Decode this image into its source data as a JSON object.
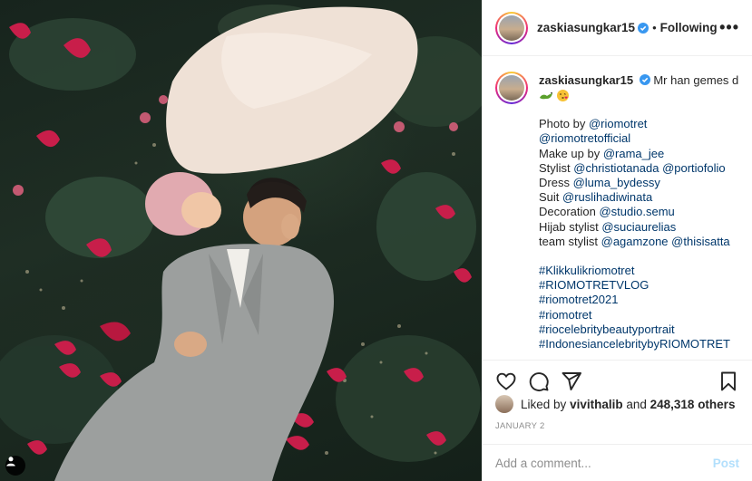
{
  "post": {
    "username": "zaskiasungkar15",
    "follow_status": "Following",
    "more_label": "•••"
  },
  "caption": {
    "username": "zaskiasungkar15",
    "text": "Mr han gemes d",
    "emojis": [
      "lizard",
      "kissing-heart-face"
    ],
    "lines": [
      {
        "prefix": "Photo by ",
        "link": "@riomotret"
      },
      {
        "prefix": "",
        "link": "@riomotretofficial"
      },
      {
        "prefix": "Make up by ",
        "link": "@rama_jee"
      },
      {
        "prefix": "Stylist ",
        "link": "@christiotanada",
        "link2": "@portiofolio"
      },
      {
        "prefix": "Dress ",
        "link": "@luma_bydessy"
      },
      {
        "prefix": "Suit ",
        "link": "@ruslihadiwinata"
      },
      {
        "prefix": "Decoration ",
        "link": "@studio.semu"
      },
      {
        "prefix": "Hijab stylist ",
        "link": "@suciaurelias"
      },
      {
        "prefix": "team stylist ",
        "link": "@agamzone",
        "link2": "@thisisatta"
      }
    ],
    "hashtags": [
      "#Klikkulikriomotret",
      "#RIOMOTRETVLOG",
      "#riomotret2021",
      "#riomotret",
      "#riocelebritybeautyportrait",
      "#IndonesiancelebritybyRIOMOTRET"
    ]
  },
  "likes": {
    "prefix": "Liked by",
    "user": "vivithalib",
    "conjunction": "and",
    "count": "248,318 others"
  },
  "date": "JANUARY 2",
  "comment": {
    "placeholder": "Add a comment...",
    "post_label": "Post"
  },
  "colors": {
    "link": "#00376b",
    "post_button": "#b2dffc",
    "verified": "#3897f0"
  }
}
